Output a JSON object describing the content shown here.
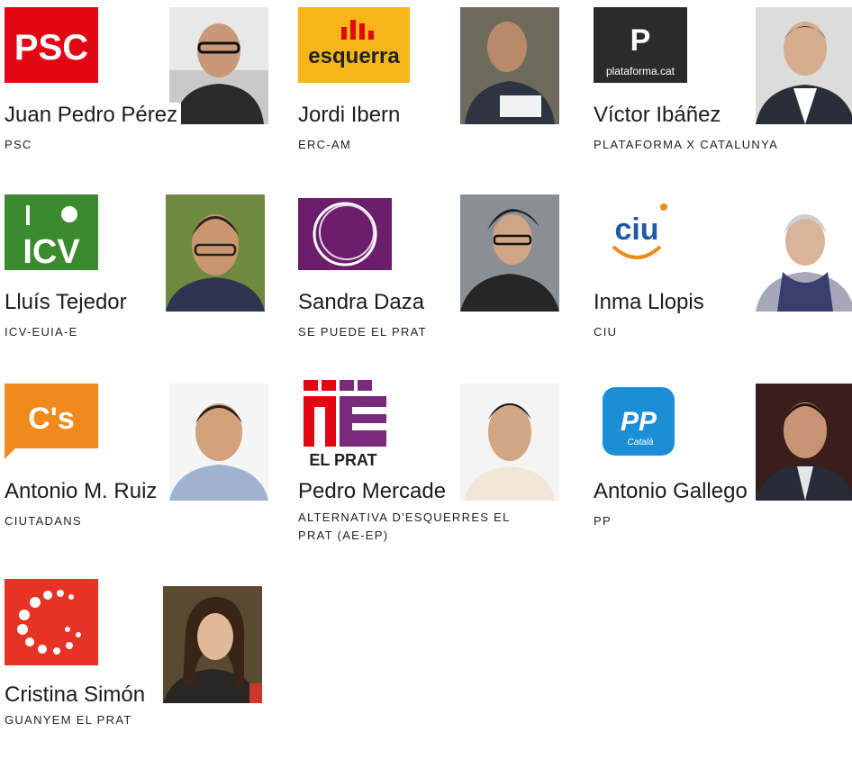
{
  "candidates": [
    {
      "name": "Juan Pedro Pérez",
      "party": "PSC",
      "logo_text": "PSC",
      "photo_icon": "man-glasses-portrait"
    },
    {
      "name": "Jordi Ibern",
      "party": "ERC-AM",
      "logo_text": "esquerra",
      "photo_icon": "man-holding-paper-portrait"
    },
    {
      "name": "Víctor Ibáñez",
      "party": "PLATAFORMA X CATALUNYA",
      "logo_text": "plataforma.cat",
      "photo_icon": "man-suit-portrait"
    },
    {
      "name": "Lluís Tejedor",
      "party": "ICV-EUIA-E",
      "logo_text": "ICV",
      "photo_icon": "man-glasses-portrait"
    },
    {
      "name": "Sandra Daza",
      "party": "SE PUEDE EL PRAT",
      "logo_text": "",
      "photo_icon": "woman-glasses-portrait"
    },
    {
      "name": "Inma Llopis",
      "party": "CIU",
      "logo_text": "ciu",
      "photo_icon": "woman-scarf-portrait"
    },
    {
      "name": "Antonio M. Ruiz",
      "party": "CIUTADANS",
      "logo_text": "C's",
      "photo_icon": "man-smiling-portrait"
    },
    {
      "name": "Pedro Mercade",
      "party": "ALTERNATIVA D'ESQUERRES EL PRAT (AE-EP)",
      "logo_text": "EL PRAT",
      "photo_icon": "man-smiling-portrait"
    },
    {
      "name": "Antonio Gallego",
      "party": "PP",
      "logo_text": "PP",
      "logo_sub": "Català",
      "photo_icon": "man-suit-portrait"
    },
    {
      "name": "Cristina Simón",
      "party": "GUANYEM EL PRAT",
      "logo_text": "",
      "photo_icon": "woman-portrait"
    }
  ],
  "colors": {
    "psc": "#e30613",
    "esquerra": "#f7b519",
    "pxc": "#2b2b2b",
    "icv": "#3c8a2e",
    "sepuede": "#6b1e6b",
    "ciu": "#1e5aa8",
    "cs": "#f08a1c",
    "aeep": "#7a2a7a",
    "pp": "#1a8fd8",
    "guanyem": "#e63323"
  }
}
